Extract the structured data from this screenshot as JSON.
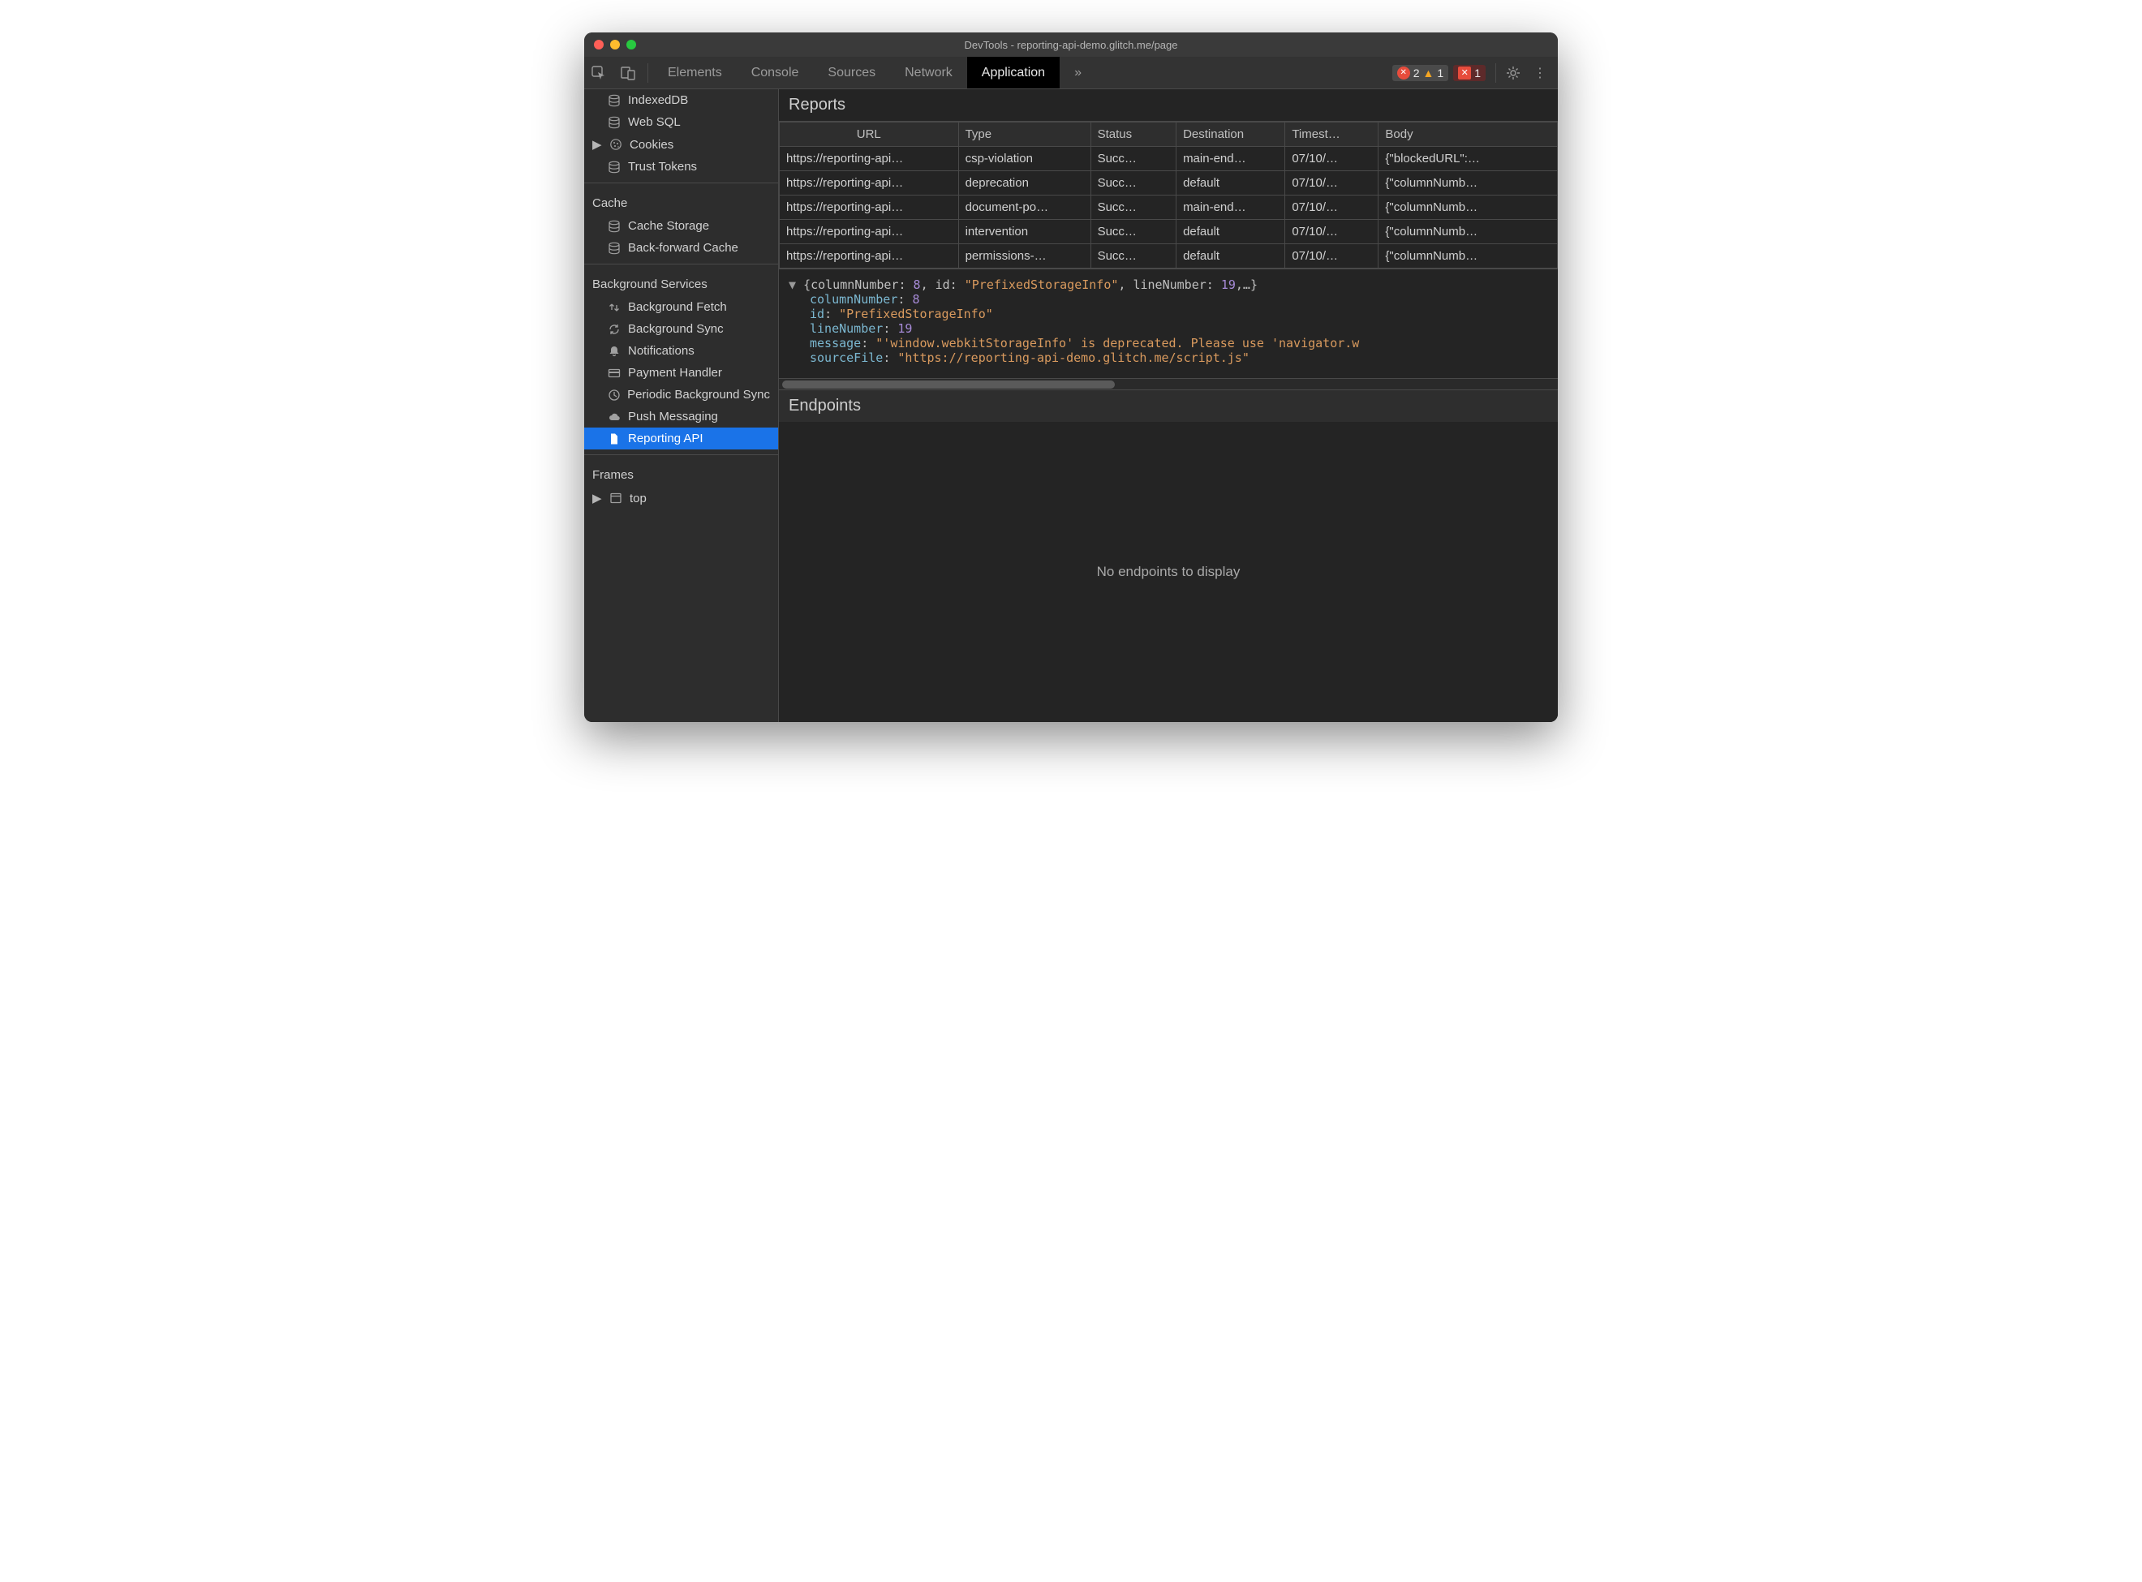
{
  "window_title": "DevTools - reporting-api-demo.glitch.me/page",
  "tabs": [
    "Elements",
    "Console",
    "Sources",
    "Network",
    "Application"
  ],
  "active_tab": "Application",
  "status_badges": {
    "errors": 2,
    "warnings": 1,
    "violations": 1
  },
  "sidebar": {
    "storage": {
      "items": [
        {
          "label": "IndexedDB",
          "icon": "database",
          "expandable": false
        },
        {
          "label": "Web SQL",
          "icon": "database",
          "expandable": false
        },
        {
          "label": "Cookies",
          "icon": "cookie",
          "expandable": true
        },
        {
          "label": "Trust Tokens",
          "icon": "database",
          "expandable": false
        }
      ]
    },
    "cache": {
      "title": "Cache",
      "items": [
        {
          "label": "Cache Storage",
          "icon": "database"
        },
        {
          "label": "Back-forward Cache",
          "icon": "database"
        }
      ]
    },
    "background": {
      "title": "Background Services",
      "items": [
        {
          "label": "Background Fetch",
          "icon": "updown"
        },
        {
          "label": "Background Sync",
          "icon": "sync"
        },
        {
          "label": "Notifications",
          "icon": "bell"
        },
        {
          "label": "Payment Handler",
          "icon": "card"
        },
        {
          "label": "Periodic Background Sync",
          "icon": "clock"
        },
        {
          "label": "Push Messaging",
          "icon": "cloud"
        },
        {
          "label": "Reporting API",
          "icon": "file",
          "selected": true
        }
      ]
    },
    "frames": {
      "title": "Frames",
      "items": [
        {
          "label": "top",
          "icon": "frame",
          "expandable": true
        }
      ]
    }
  },
  "reports": {
    "title": "Reports",
    "columns": [
      "URL",
      "Type",
      "Status",
      "Destination",
      "Timest…",
      "Body"
    ],
    "rows": [
      {
        "url": "https://reporting-api…",
        "type": "csp-violation",
        "status": "Succ…",
        "dest": "main-end…",
        "ts": "07/10/…",
        "body": "{\"blockedURL\":…"
      },
      {
        "url": "https://reporting-api…",
        "type": "deprecation",
        "status": "Succ…",
        "dest": "default",
        "ts": "07/10/…",
        "body": "{\"columnNumb…"
      },
      {
        "url": "https://reporting-api…",
        "type": "document-po…",
        "status": "Succ…",
        "dest": "main-end…",
        "ts": "07/10/…",
        "body": "{\"columnNumb…"
      },
      {
        "url": "https://reporting-api…",
        "type": "intervention",
        "status": "Succ…",
        "dest": "default",
        "ts": "07/10/…",
        "body": "{\"columnNumb…"
      },
      {
        "url": "https://reporting-api…",
        "type": "permissions-…",
        "status": "Succ…",
        "dest": "default",
        "ts": "07/10/…",
        "body": "{\"columnNumb…"
      }
    ]
  },
  "detail": {
    "summary_prefix": "{columnNumber: ",
    "summary_col": "8",
    "summary_mid": ", id: ",
    "summary_id": "\"PrefixedStorageInfo\"",
    "summary_mid2": ", lineNumber: ",
    "summary_line": "19",
    "summary_suffix": ",…}",
    "columnNumber": "8",
    "id": "\"PrefixedStorageInfo\"",
    "lineNumber": "19",
    "message": "\"'window.webkitStorageInfo' is deprecated. Please use 'navigator.w",
    "sourceFile": "\"https://reporting-api-demo.glitch.me/script.js\"",
    "k_columnNumber": "columnNumber",
    "k_id": "id",
    "k_lineNumber": "lineNumber",
    "k_message": "message",
    "k_sourceFile": "sourceFile"
  },
  "endpoints": {
    "title": "Endpoints",
    "empty": "No endpoints to display"
  }
}
